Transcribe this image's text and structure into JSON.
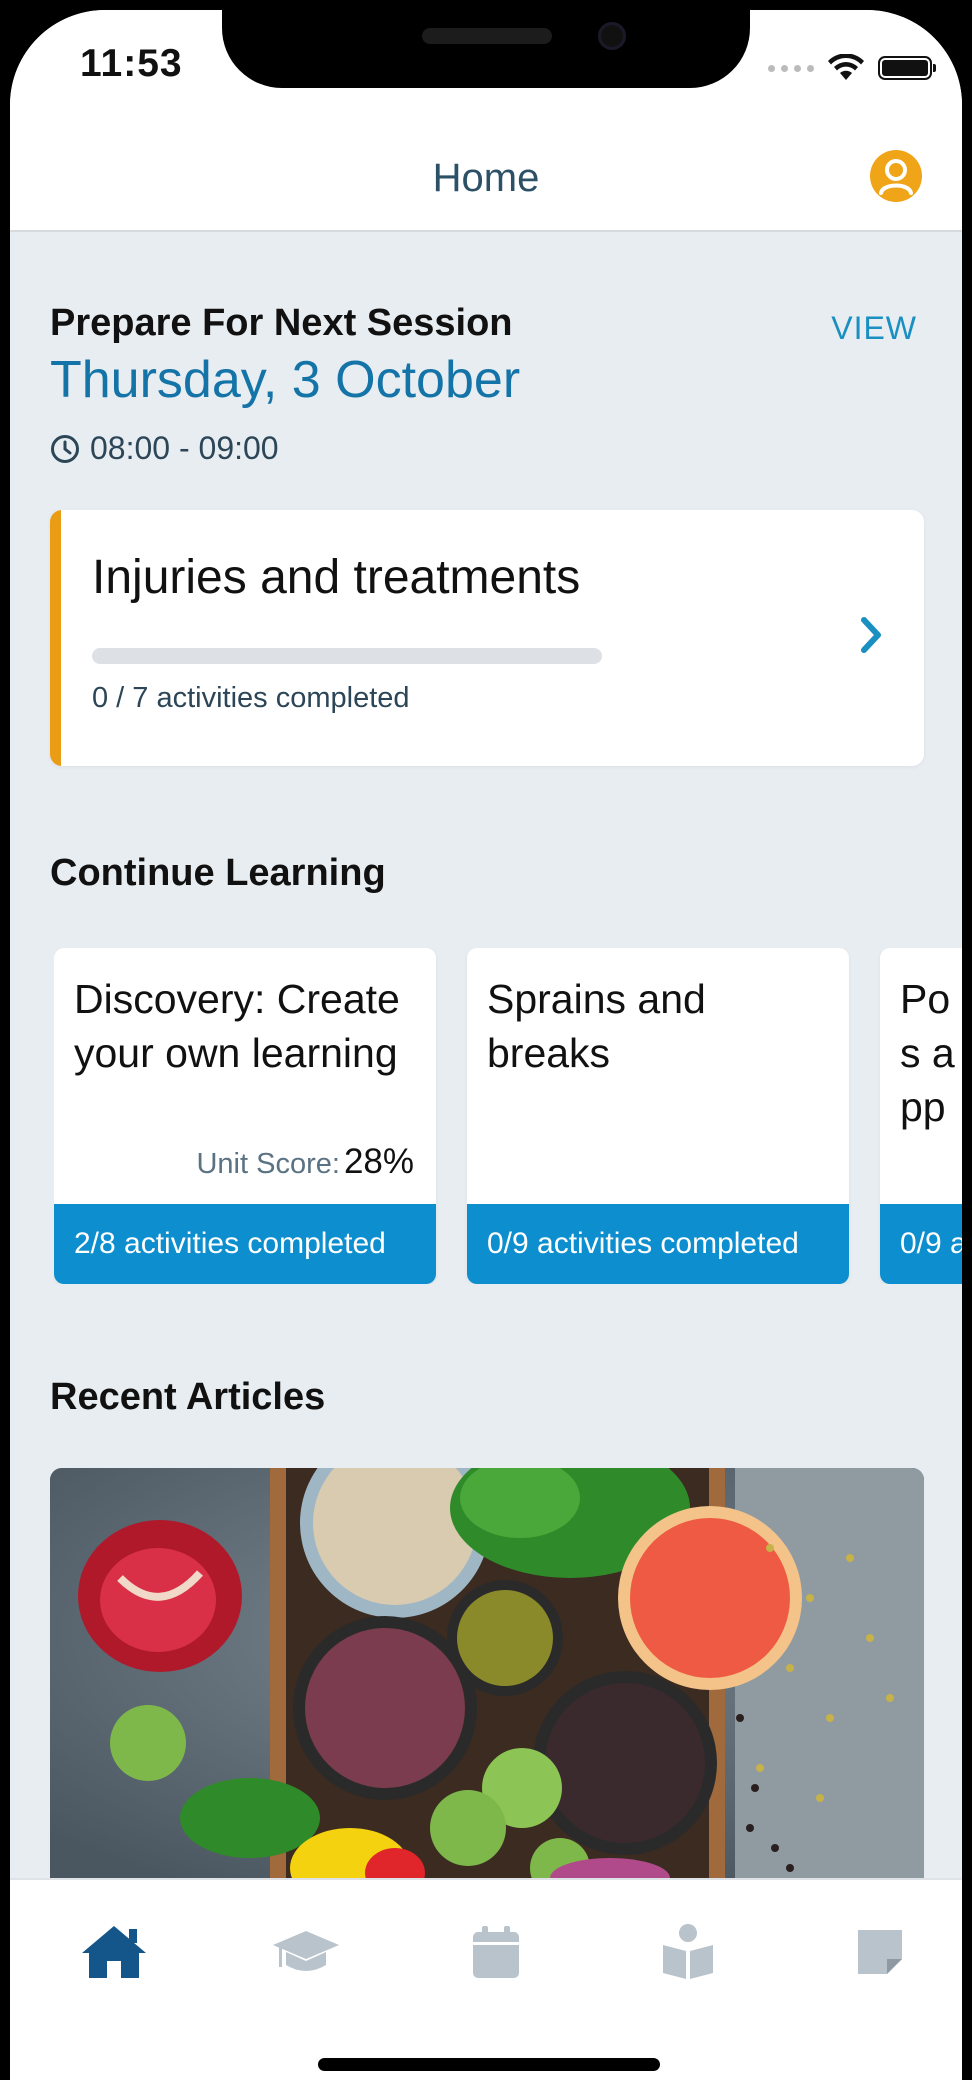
{
  "status_bar": {
    "time": "11:53"
  },
  "header": {
    "title": "Home"
  },
  "session": {
    "heading": "Prepare For Next Session",
    "view_label": "VIEW",
    "date": "Thursday, 3 October",
    "time_range": "08:00 - 09:00",
    "card": {
      "title": "Injuries and treatments",
      "progress_text": "0 / 7 activities completed",
      "completed": 0,
      "total": 7
    }
  },
  "continue_learning": {
    "heading": "Continue Learning",
    "cards": [
      {
        "title": "Discovery: Create your own learning",
        "score_label": "Unit Score:",
        "score_value": "28%",
        "footer": "2/8 activities completed"
      },
      {
        "title": "Sprains and breaks",
        "footer": "0/9 activities completed"
      },
      {
        "title": "Pos app",
        "footer": "0/9 a"
      }
    ]
  },
  "recent_articles": {
    "heading": "Recent Articles"
  },
  "tabs": [
    {
      "name": "home",
      "icon": "home-icon",
      "active": true
    },
    {
      "name": "learning",
      "icon": "graduation-cap-icon",
      "active": false
    },
    {
      "name": "calendar",
      "icon": "calendar-icon",
      "active": false
    },
    {
      "name": "library",
      "icon": "book-reader-icon",
      "active": false
    },
    {
      "name": "notes",
      "icon": "sticky-note-icon",
      "active": false
    }
  ],
  "colors": {
    "accent_blue": "#1474a8",
    "link_blue": "#1a8fc2",
    "card_footer_blue": "#0d8ecf",
    "accent_orange": "#e99c14",
    "tab_active": "#15568a",
    "tab_inactive": "#b9c3cb"
  }
}
